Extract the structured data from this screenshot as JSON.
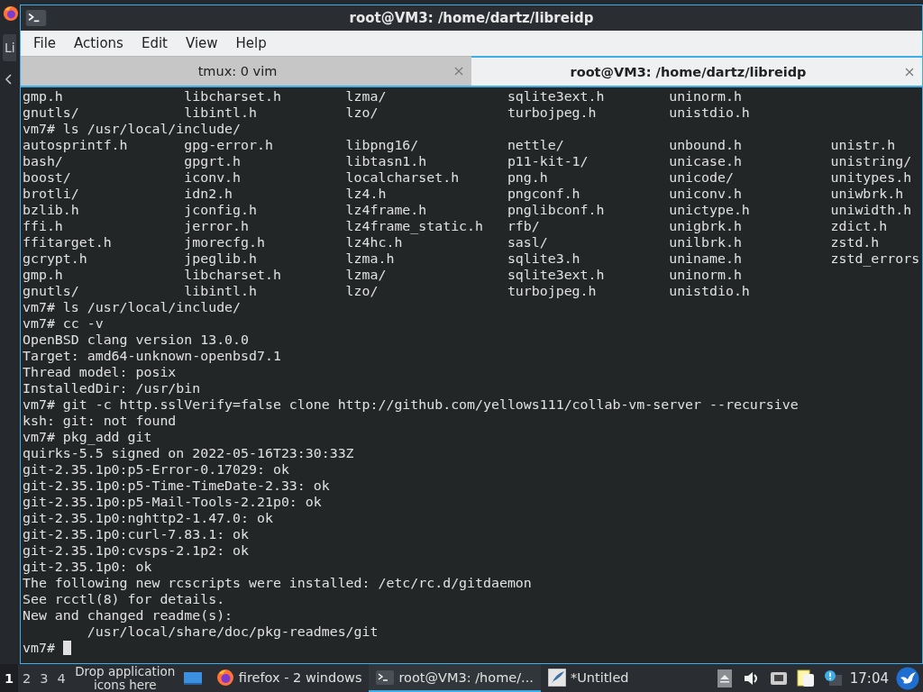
{
  "background_window": {
    "label": "Li"
  },
  "window": {
    "title": "root@VM3: /home/dartz/libreidp"
  },
  "menu": [
    "File",
    "Actions",
    "Edit",
    "View",
    "Help"
  ],
  "tabs": [
    {
      "label": "tmux: 0 vim",
      "selected": false
    },
    {
      "label": "root@VM3: /home/dartz/libreidp",
      "selected": true
    }
  ],
  "terminal": {
    "lines": [
      {
        "kind": "columns",
        "cells": [
          "gmp.h",
          "libcharset.h",
          "lzma/",
          "sqlite3ext.h",
          "uninorm.h"
        ]
      },
      {
        "kind": "columns",
        "cells": [
          "gnutls/",
          "libintl.h",
          "lzo/",
          "turbojpeg.h",
          "unistdio.h"
        ]
      },
      {
        "kind": "text",
        "text": "vm7# ls /usr/local/include/"
      },
      {
        "kind": "columns",
        "cells": [
          "autosprintf.h",
          "gpg-error.h",
          "libpng16/",
          "nettle/",
          "unbound.h",
          "unistr.h"
        ]
      },
      {
        "kind": "columns",
        "cells": [
          "bash/",
          "gpgrt.h",
          "libtasn1.h",
          "p11-kit-1/",
          "unicase.h",
          "unistring/"
        ]
      },
      {
        "kind": "columns",
        "cells": [
          "boost/",
          "iconv.h",
          "localcharset.h",
          "png.h",
          "unicode/",
          "unitypes.h"
        ]
      },
      {
        "kind": "columns",
        "cells": [
          "brotli/",
          "idn2.h",
          "lz4.h",
          "pngconf.h",
          "uniconv.h",
          "uniwbrk.h"
        ]
      },
      {
        "kind": "columns",
        "cells": [
          "bzlib.h",
          "jconfig.h",
          "lz4frame.h",
          "pnglibconf.h",
          "unictype.h",
          "uniwidth.h"
        ]
      },
      {
        "kind": "columns",
        "cells": [
          "ffi.h",
          "jerror.h",
          "lz4frame_static.h",
          "rfb/",
          "unigbrk.h",
          "zdict.h"
        ]
      },
      {
        "kind": "columns",
        "cells": [
          "ffitarget.h",
          "jmorecfg.h",
          "lz4hc.h",
          "sasl/",
          "unilbrk.h",
          "zstd.h"
        ]
      },
      {
        "kind": "columns",
        "cells": [
          "gcrypt.h",
          "jpeglib.h",
          "lzma.h",
          "sqlite3.h",
          "uniname.h",
          "zstd_errors"
        ]
      },
      {
        "kind": "columns",
        "cells": [
          "gmp.h",
          "libcharset.h",
          "lzma/",
          "sqlite3ext.h",
          "uninorm.h"
        ]
      },
      {
        "kind": "columns",
        "cells": [
          "gnutls/",
          "libintl.h",
          "lzo/",
          "turbojpeg.h",
          "unistdio.h"
        ]
      },
      {
        "kind": "text",
        "text": "vm7# ls /usr/local/include/"
      },
      {
        "kind": "text",
        "text": "vm7# cc -v"
      },
      {
        "kind": "text",
        "text": "OpenBSD clang version 13.0.0"
      },
      {
        "kind": "text",
        "text": "Target: amd64-unknown-openbsd7.1"
      },
      {
        "kind": "text",
        "text": "Thread model: posix"
      },
      {
        "kind": "text",
        "text": "InstalledDir: /usr/bin"
      },
      {
        "kind": "text",
        "text": "vm7# git -c http.sslVerify=false clone http://github.com/yellows111/collab-vm-server --recursive"
      },
      {
        "kind": "text",
        "text": "ksh: git: not found"
      },
      {
        "kind": "text",
        "text": "vm7# pkg_add git"
      },
      {
        "kind": "text",
        "text": "quirks-5.5 signed on 2022-05-16T23:30:33Z"
      },
      {
        "kind": "text",
        "text": "git-2.35.1p0:p5-Error-0.17029: ok"
      },
      {
        "kind": "text",
        "text": "git-2.35.1p0:p5-Time-TimeDate-2.33: ok"
      },
      {
        "kind": "text",
        "text": "git-2.35.1p0:p5-Mail-Tools-2.21p0: ok"
      },
      {
        "kind": "text",
        "text": "git-2.35.1p0:nghttp2-1.47.0: ok"
      },
      {
        "kind": "text",
        "text": "git-2.35.1p0:curl-7.83.1: ok"
      },
      {
        "kind": "text",
        "text": "git-2.35.1p0:cvsps-2.1p2: ok"
      },
      {
        "kind": "text",
        "text": "git-2.35.1p0: ok"
      },
      {
        "kind": "text",
        "text": "The following new rcscripts were installed: /etc/rc.d/gitdaemon"
      },
      {
        "kind": "text",
        "text": "See rcctl(8) for details."
      },
      {
        "kind": "text",
        "text": "New and changed readme(s):"
      },
      {
        "kind": "indented",
        "text": "/usr/local/share/doc/pkg-readmes/git"
      },
      {
        "kind": "prompt",
        "text": "vm7#",
        "cursor": true
      }
    ]
  },
  "taskbar": {
    "workspaces": [
      {
        "label": "1",
        "selected": true
      },
      {
        "label": "2",
        "selected": false
      },
      {
        "label": "3",
        "selected": false
      },
      {
        "label": "4",
        "selected": false
      }
    ],
    "launcher_hint": "Drop application icons here",
    "tasks": [
      {
        "kind": "firefox",
        "label": "firefox - 2 windows",
        "selected": false
      },
      {
        "kind": "terminal",
        "label": "root@VM3: /home/...",
        "selected": true
      },
      {
        "kind": "editor",
        "label": "*Untitled",
        "selected": false
      }
    ],
    "clock": "17:04"
  }
}
